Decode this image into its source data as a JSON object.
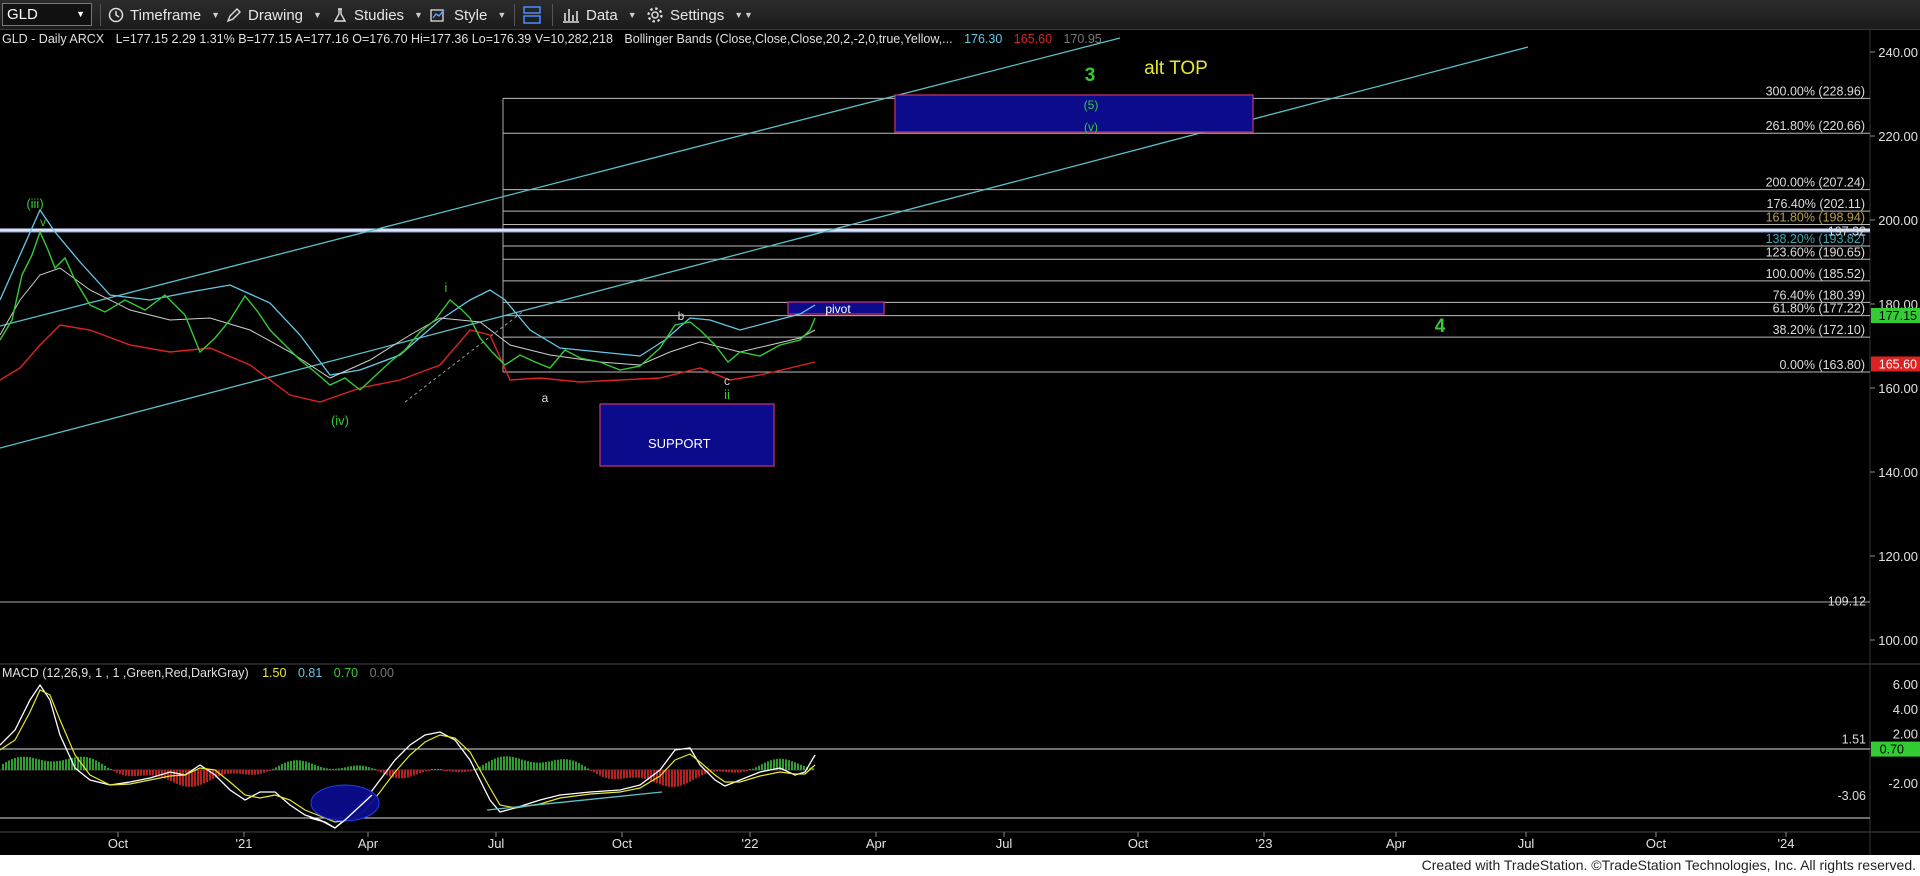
{
  "toolbar": {
    "symbol": "GLD",
    "timeframe_label": "Timeframe",
    "drawing_label": "Drawing",
    "studies_label": "Studies",
    "style_label": "Style",
    "data_label": "Data",
    "settings_label": "Settings",
    "icons": [
      "clock-icon",
      "pencil-icon",
      "flask-icon",
      "chart-style-icon",
      "window-layout-icon",
      "bar-chart-icon",
      "gear-icon"
    ]
  },
  "header": {
    "symbol_info": "GLD - Daily  ARCX",
    "ohlc": "L=177.15  2.29  1.31%  B=177.15  A=177.16  O=176.70  Hi=177.36  Lo=176.39  V=10,282,218",
    "indicator": "Bollinger Bands (Close,Close,Close,20,2,-2,0,true,Yellow,...",
    "bb_upper": "176.30",
    "bb_lower": "165.60",
    "bb_mid": "170.95"
  },
  "macd_header": {
    "label": "MACD (12,26,9, 1 , 1 ,Green,Red,DarkGray)",
    "v1": "1.50",
    "v2": "0.81",
    "v3": "0.70",
    "v4": "0.00"
  },
  "colors": {
    "price": "#33cc33",
    "bb_upper": "#66c8e6",
    "bb_lower": "#dd2222",
    "bb_mid": "#cfcfcf",
    "channel": "#5bc0c8",
    "fib": "#bbbbbb",
    "box": "#0b0b8c",
    "box_border": "#cc3377",
    "wave_green": "#33cc33",
    "alt_top": "#e8e830",
    "last_price_bg": "#33cc33",
    "lower_band_bg": "#dd2222"
  },
  "main_axis": {
    "ticks": [
      "240.00",
      "220.00",
      "200.00",
      "180.00",
      "160.00",
      "140.00",
      "120.00",
      "100.00"
    ],
    "levels": [
      {
        "label": "197.32",
        "value": 197.32,
        "bg": "none"
      },
      {
        "label": "177.15",
        "value": 177.15,
        "bg": "green"
      },
      {
        "label": "165.60",
        "value": 165.6,
        "bg": "red"
      },
      {
        "label": "109.12",
        "value": 109.12,
        "bg": "none"
      }
    ]
  },
  "macd_axis": {
    "ticks": [
      "6.00",
      "4.00",
      "2.00",
      "-2.00"
    ],
    "levels": [
      {
        "label": "1.51",
        "value": 1.51,
        "bg": "none"
      },
      {
        "label": "0.70",
        "value": 0.7,
        "bg": "green"
      },
      {
        "label": "-3.06",
        "value": -3.06,
        "bg": "none"
      }
    ]
  },
  "x_axis": {
    "labels": [
      "Oct",
      "'21",
      "Apr",
      "Jul",
      "Oct",
      "'22",
      "Apr",
      "Jul",
      "Oct",
      "'23",
      "Apr",
      "Jul",
      "Oct",
      "'24"
    ]
  },
  "fib_levels": [
    {
      "label": "300.00% (228.96)",
      "value": 228.96
    },
    {
      "label": "261.80% (220.66)",
      "value": 220.66
    },
    {
      "label": "200.00% (207.24)",
      "value": 207.24
    },
    {
      "label": "176.40% (202.11)",
      "value": 202.11
    },
    {
      "label": "161.80% (198.94)",
      "value": 198.94
    },
    {
      "label": "138.20% (193.82)",
      "value": 193.82
    },
    {
      "label": "123.60% (190.65)",
      "value": 190.65
    },
    {
      "label": "100.00% (185.52)",
      "value": 185.52
    },
    {
      "label": "76.40% (180.39)",
      "value": 180.39
    },
    {
      "label": "61.80% (177.22)",
      "value": 177.22
    },
    {
      "label": "38.20% (172.10)",
      "value": 172.1
    },
    {
      "label": "0.00% (163.80)",
      "value": 163.8
    }
  ],
  "annotations": {
    "wave_iii": "(iii)",
    "wave_iii_v": "v",
    "wave_iv": "(iv)",
    "wave_i": "i",
    "wave_a": "a",
    "wave_b": "b",
    "wave_c": "c",
    "wave_ii": "ii",
    "wave_3": "3",
    "alt_top": "alt TOP",
    "wave_5": "(5)",
    "wave_v": "(v)",
    "wave_4": "4",
    "pivot": "pivot",
    "support": "SUPPORT"
  },
  "footer": {
    "text": "Created with TradeStation. ©TradeStation Technologies, Inc. All rights reserved."
  }
}
